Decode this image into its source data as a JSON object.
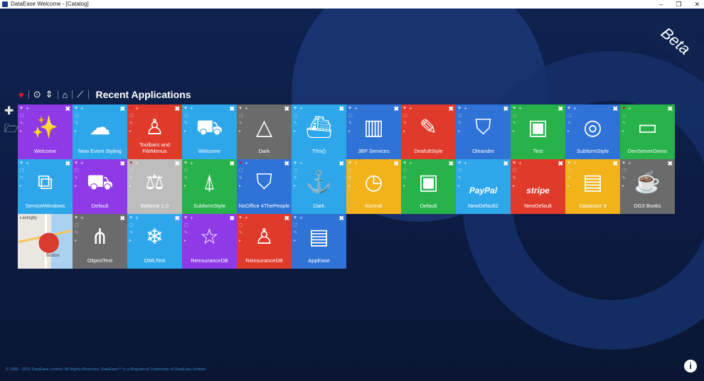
{
  "window": {
    "title": "DataEase Welcome - [Catalog]",
    "controls": [
      "–",
      "❐",
      "✕"
    ]
  },
  "beta_label": "Beta",
  "toolbar": {
    "title": "Recent Applications"
  },
  "footer": "© 1980 - 2019 DataEase Limited. All Rights Reserved. DataEase™ is a Registered Trademark of DataEase Limited.",
  "map_tile": {
    "town1": "Lexingby",
    "town2": "Boston"
  },
  "tiles": [
    {
      "label": "Welcome",
      "glyph": "✨",
      "color": "#8e3ae6",
      "fav": false
    },
    {
      "label": "New Event Styling",
      "glyph": "☁",
      "color": "#2ea7ea",
      "fav": false
    },
    {
      "label": "Toolbars and FileMenus",
      "glyph": "♙",
      "color": "#e03a2a",
      "fav": true
    },
    {
      "label": "Welcome",
      "glyph": "⛟",
      "color": "#2ea7ea",
      "fav": false
    },
    {
      "label": "Dark",
      "glyph": "△",
      "color": "#6b6b6b",
      "fav": false
    },
    {
      "label": "This()",
      "glyph": "⛴",
      "color": "#2ea7ea",
      "fav": false
    },
    {
      "label": "JBP Services",
      "glyph": "▥",
      "color": "#2f73d6",
      "fav": false
    },
    {
      "label": "DeafultStyle",
      "glyph": "✎",
      "color": "#e03a2a",
      "fav": false
    },
    {
      "label": "Oleandre",
      "glyph": "⛉",
      "color": "#2f73d6",
      "fav": false
    },
    {
      "label": "Test",
      "glyph": "▣",
      "color": "#27b24a",
      "fav": false
    },
    {
      "label": "SubformStyle",
      "glyph": "◎",
      "color": "#2f73d6",
      "fav": false
    },
    {
      "label": "DevServerDemo",
      "glyph": "▭",
      "color": "#27b24a",
      "fav": true
    },
    {
      "label": "ServiceWindows",
      "glyph": "⧉",
      "color": "#2ea7ea",
      "fav": false
    },
    {
      "label": "Default",
      "glyph": "⛟",
      "color": "#8e3ae6",
      "fav": false
    },
    {
      "label": "Website 1.0",
      "glyph": "⚖",
      "color": "#bdbdbd",
      "fav": true
    },
    {
      "label": "SubformStyle",
      "glyph": "⍋",
      "color": "#27b24a",
      "fav": false
    },
    {
      "label": "NoOffice 4ThePeople",
      "glyph": "⛉",
      "color": "#2f73d6",
      "fav": true
    },
    {
      "label": "Dark",
      "glyph": "⚓",
      "color": "#2ea7ea",
      "fav": false
    },
    {
      "label": "Normal",
      "glyph": "◷",
      "color": "#f1b21a",
      "fav": false
    },
    {
      "label": "Default",
      "glyph": "▣",
      "color": "#27b24a",
      "fav": false
    },
    {
      "label": "NewDefault2",
      "glyph": "PayPal",
      "color": "#2ea7ea",
      "fav": false
    },
    {
      "label": "NewDefault",
      "glyph": "stripe",
      "color": "#e03a2a",
      "fav": false
    },
    {
      "label": "Dataease 9",
      "glyph": "▤",
      "color": "#f1b21a",
      "fav": false
    },
    {
      "label": "DG3 Books",
      "glyph": "☕",
      "color": "#6b6b6b",
      "fav": false
    },
    {
      "label": "",
      "glyph": "",
      "color": "#e9e7e0",
      "fav": false,
      "map": true
    },
    {
      "label": "ObjectTest",
      "glyph": "⋔",
      "color": "#6b6b6b",
      "fav": false
    },
    {
      "label": "OMLTest",
      "glyph": "❄",
      "color": "#2ea7ea",
      "fav": false
    },
    {
      "label": "ReinsuranceDB",
      "glyph": "☆",
      "color": "#8e3ae6",
      "fav": false
    },
    {
      "label": "ReinsuranceDB",
      "glyph": "♙",
      "color": "#e03a2a",
      "fav": false
    },
    {
      "label": "AppEase",
      "glyph": "▤",
      "color": "#2f73d6",
      "fav": false
    }
  ]
}
